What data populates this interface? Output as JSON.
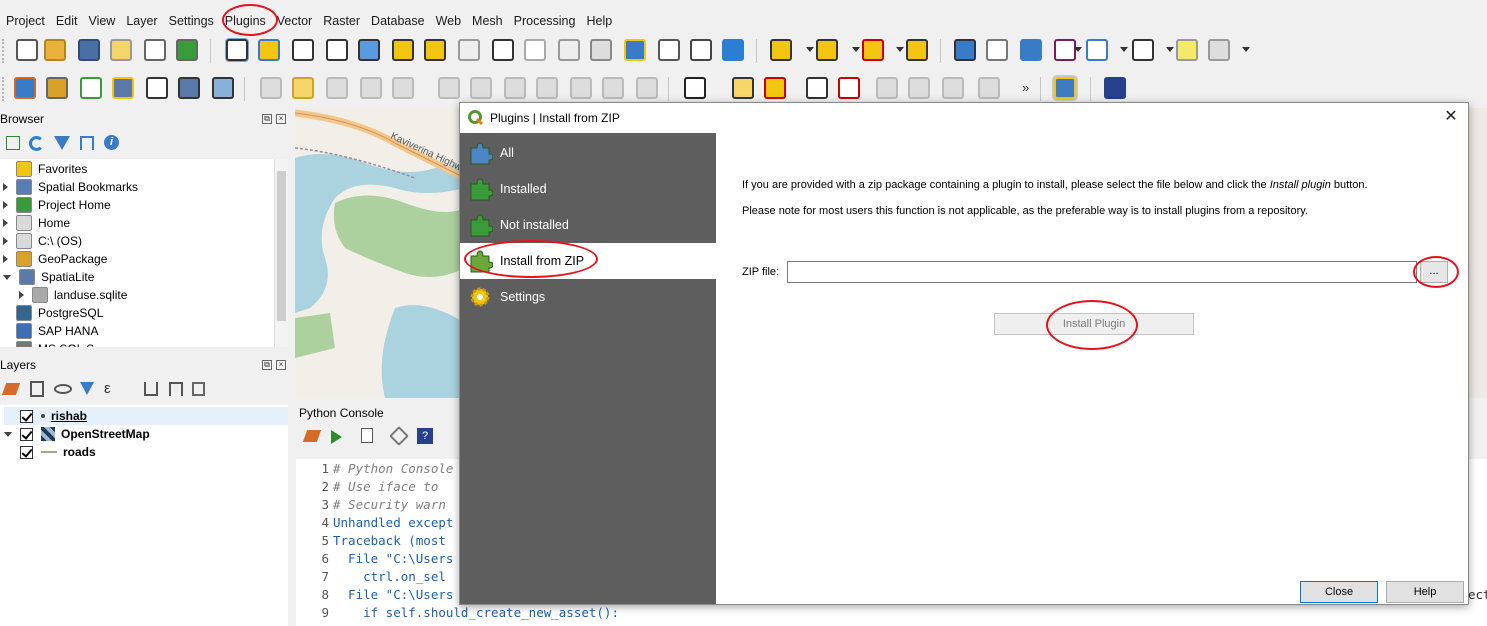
{
  "menu": [
    "Project",
    "Edit",
    "View",
    "Layer",
    "Settings",
    "Plugins",
    "Vector",
    "Raster",
    "Database",
    "Web",
    "Mesh",
    "Processing",
    "Help"
  ],
  "browser_panel": {
    "title": "Browser",
    "items": [
      {
        "label": "Favorites",
        "icon": "star-icon",
        "color": "#f2c511"
      },
      {
        "label": "Spatial Bookmarks",
        "icon": "bookmark-icon",
        "color": "#5a7db5"
      },
      {
        "label": "Project Home",
        "icon": "project-home-icon",
        "color": "#3a9b3a"
      },
      {
        "label": "Home",
        "icon": "folder-icon",
        "color": "#d9d9d9"
      },
      {
        "label": "C:\\ (OS)",
        "icon": "drive-icon",
        "color": "#d9d9d9"
      },
      {
        "label": "GeoPackage",
        "icon": "geopackage-icon",
        "color": "#d7a12a"
      },
      {
        "label": "SpatiaLite",
        "icon": "spatialite-icon",
        "color": "#5b7aa8"
      },
      {
        "label": "landuse.sqlite",
        "icon": "database-icon",
        "color": "#a9a9a9"
      },
      {
        "label": "PostgreSQL",
        "icon": "postgresql-icon",
        "color": "#336791"
      },
      {
        "label": "SAP HANA",
        "icon": "sap-hana-icon",
        "color": "#3c6fb6"
      },
      {
        "label": "MS SQL S",
        "icon": "mssql-icon",
        "color": "#777"
      }
    ]
  },
  "layers_panel": {
    "title": "Layers",
    "layers": [
      {
        "label": "rishab"
      },
      {
        "label": "OpenStreetMap"
      },
      {
        "label": "roads"
      }
    ]
  },
  "map": {
    "road_label": "Kaviverina Highway"
  },
  "python_console": {
    "title": "Python Console",
    "lines": [
      {
        "n": "1",
        "text": "# Python Console",
        "kind": "cm"
      },
      {
        "n": "2",
        "text": "# Use iface to",
        "kind": "cm"
      },
      {
        "n": "3",
        "text": "# Security warn",
        "kind": "cm"
      },
      {
        "n": "4",
        "text": "Unhandled except",
        "kind": "kw"
      },
      {
        "n": "5",
        "text": "Traceback (most",
        "kind": "kw"
      },
      {
        "n": "6",
        "text": "  File \"C:\\Users",
        "kind": "kw"
      },
      {
        "n": "7",
        "text": "    ctrl.on_sel",
        "kind": "kw"
      },
      {
        "n": "8",
        "text": "  File \"C:\\Users",
        "kind": "kw"
      },
      {
        "n": "9",
        "text": "    if self.should_create_new_asset():",
        "kind": "kw"
      }
    ],
    "overflow_tail": "ect"
  },
  "dialog": {
    "title": "Plugins | Install from ZIP",
    "close_glyph": "✕",
    "sidebar": [
      {
        "label": "All",
        "icon": "puzzle-all-icon"
      },
      {
        "label": "Installed",
        "icon": "puzzle-installed-icon"
      },
      {
        "label": "Not installed",
        "icon": "puzzle-not-installed-icon"
      },
      {
        "label": "Install from ZIP",
        "icon": "puzzle-zip-icon",
        "active": true
      },
      {
        "label": "Settings",
        "icon": "gear-icon"
      }
    ],
    "info_line1": "If you are provided with a zip package containing a plugin to install, please select the file below and click the Install plugin button.",
    "info_line2": "Please note for most users this function is not applicable, as the preferable way is to install plugins from a repository.",
    "zip_label": "ZIP file:",
    "zip_value": "",
    "browse_label": "...",
    "install_label": "Install Plugin",
    "close_label": "Close",
    "help_label": "Help"
  },
  "colors": {
    "sidebar_bg": "#5e5e5e",
    "annotation": "#e8111b",
    "accent": "#0078d7"
  }
}
